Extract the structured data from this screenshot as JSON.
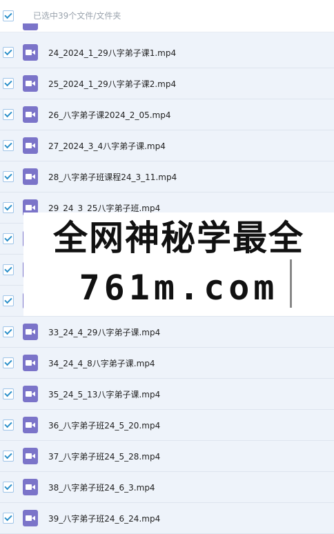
{
  "header": {
    "selection_label": "已选中39个文件/文件夹"
  },
  "files": [
    {
      "name": "24_2024_1_29八字弟子课1.mp4"
    },
    {
      "name": "25_2024_1_29八字弟子课2.mp4"
    },
    {
      "name": "26_八字弟子课2024_2_05.mp4"
    },
    {
      "name": "27_2024_3_4八字弟子课.mp4"
    },
    {
      "name": "28_八字弟子班课程24_3_11.mp4"
    },
    {
      "name": "29_24_3_25八字弟子班.mp4"
    },
    {
      "name": ""
    },
    {
      "name": ""
    },
    {
      "name": ""
    },
    {
      "name": "33_24_4_29八字弟子课.mp4"
    },
    {
      "name": "34_24_4_8八字弟子课.mp4"
    },
    {
      "name": "35_24_5_13八字弟子课.mp4"
    },
    {
      "name": "36_八字弟子班24_5_20.mp4"
    },
    {
      "name": "37_八字弟子班24_5_28.mp4"
    },
    {
      "name": "38_八字弟子班24_6_3.mp4"
    },
    {
      "name": "39_八字弟子班24_6_24.mp4"
    }
  ],
  "watermark": {
    "line1": "全网神秘学最全",
    "line2": "761m.com"
  },
  "icons": {
    "file": "video-file-icon",
    "check": "checkbox-checked-icon"
  },
  "colors": {
    "accent": "#2a8fc9",
    "file_icon": "#7b74c9",
    "row_bg": "#eef3fa"
  }
}
